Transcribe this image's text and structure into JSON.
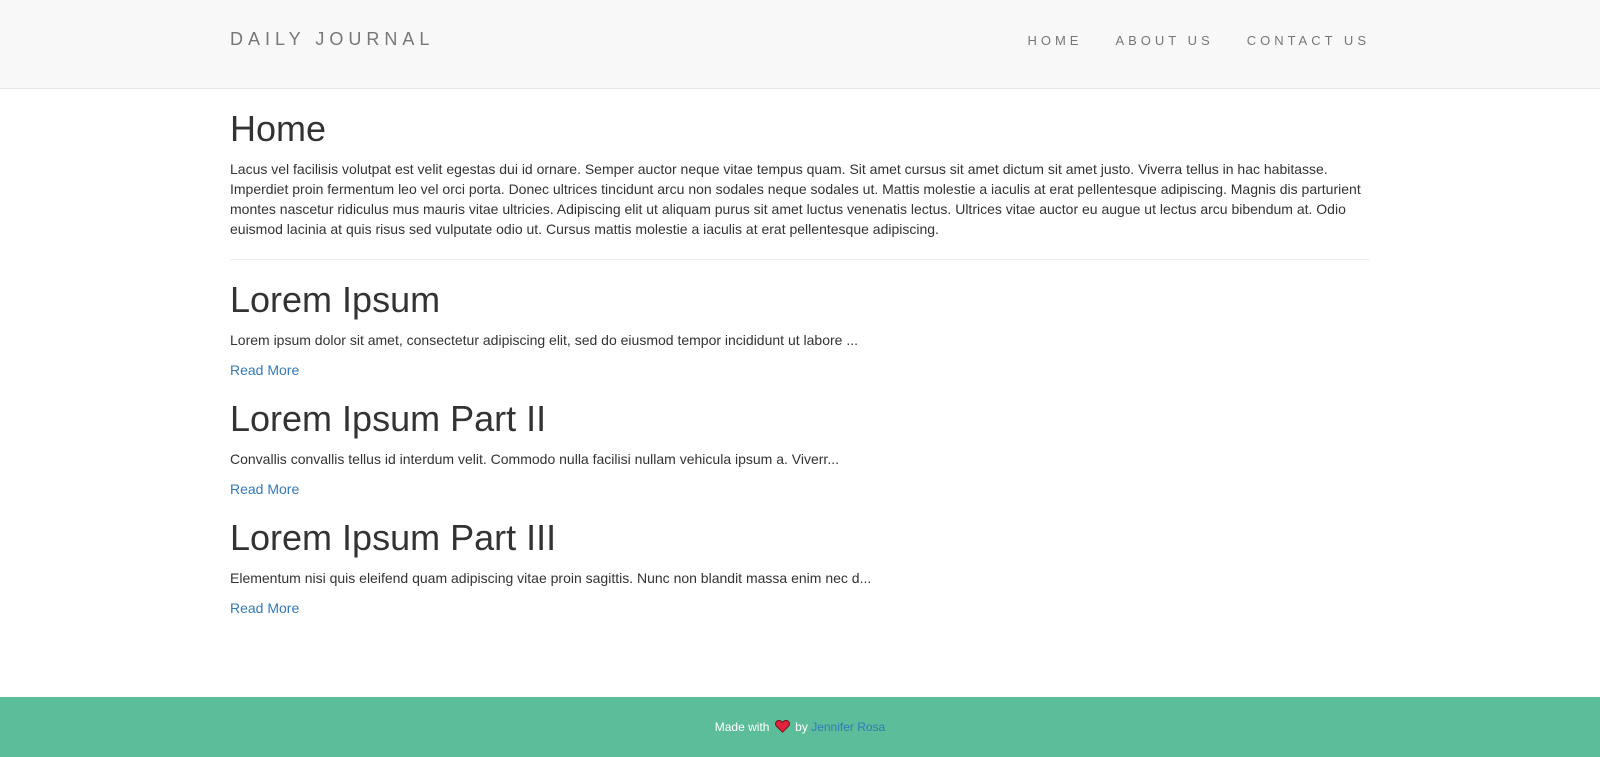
{
  "navbar": {
    "brand": "DAILY JOURNAL",
    "items": [
      {
        "label": "HOME"
      },
      {
        "label": "ABOUT US"
      },
      {
        "label": "CONTACT US"
      }
    ]
  },
  "home": {
    "title": "Home",
    "intro": "Lacus vel facilisis volutpat est velit egestas dui id ornare. Semper auctor neque vitae tempus quam. Sit amet cursus sit amet dictum sit amet justo. Viverra tellus in hac habitasse. Imperdiet proin fermentum leo vel orci porta. Donec ultrices tincidunt arcu non sodales neque sodales ut. Mattis molestie a iaculis at erat pellentesque adipiscing. Magnis dis parturient montes nascetur ridiculus mus mauris vitae ultricies. Adipiscing elit ut aliquam purus sit amet luctus venenatis lectus. Ultrices vitae auctor eu augue ut lectus arcu bibendum at. Odio euismod lacinia at quis risus sed vulputate odio ut. Cursus mattis molestie a iaculis at erat pellentesque adipiscing."
  },
  "posts": [
    {
      "title": "Lorem Ipsum",
      "excerpt": "Lorem ipsum dolor sit amet, consectetur adipiscing elit, sed do eiusmod tempor incididunt ut labore ...",
      "read_more": "Read More"
    },
    {
      "title": "Lorem Ipsum Part II",
      "excerpt": "Convallis convallis tellus id interdum velit. Commodo nulla facilisi nullam vehicula ipsum a. Viverr...",
      "read_more": "Read More"
    },
    {
      "title": "Lorem Ipsum Part III",
      "excerpt": "Elementum nisi quis eleifend quam adipiscing vitae proin sagittis. Nunc non blandit massa enim nec d...",
      "read_more": "Read More"
    }
  ],
  "footer": {
    "made_with": "Made with",
    "heart_icon": "heart-icon",
    "by": "by",
    "author": "Jennifer Rosa",
    "background_color": "#5cbd9a",
    "link_color": "#337ab7"
  }
}
